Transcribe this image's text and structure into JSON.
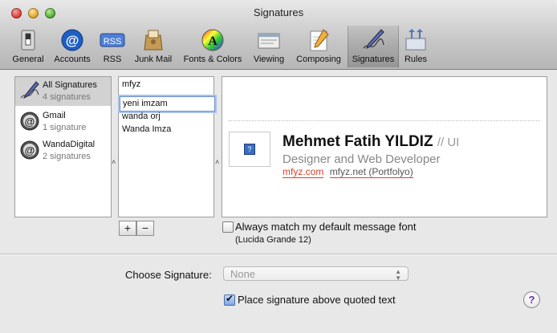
{
  "window": {
    "title": "Signatures"
  },
  "toolbar": {
    "items": [
      {
        "label": "General",
        "icon": "switch-icon"
      },
      {
        "label": "Accounts",
        "icon": "at-sign-icon"
      },
      {
        "label": "RSS",
        "icon": "rss-badge-icon"
      },
      {
        "label": "Junk Mail",
        "icon": "junk-mail-icon"
      },
      {
        "label": "Fonts & Colors",
        "icon": "font-color-icon"
      },
      {
        "label": "Viewing",
        "icon": "viewing-icon"
      },
      {
        "label": "Composing",
        "icon": "pencil-paper-icon"
      },
      {
        "label": "Signatures",
        "icon": "signature-pen-icon",
        "selected": true
      },
      {
        "label": "Rules",
        "icon": "rules-arrows-icon"
      }
    ],
    "rss_badge_text": "RSS"
  },
  "accounts": [
    {
      "name": "All Signatures",
      "count": "4 signatures",
      "selected": true
    },
    {
      "name": "Gmail",
      "count": "1 signature"
    },
    {
      "name": "WandaDigital",
      "count": "2 signatures"
    }
  ],
  "signatures": {
    "items": [
      "mfyz",
      "wanda orj",
      "Wanda Imza"
    ],
    "editing_value": "yeni imzam",
    "add_label": "+",
    "remove_label": "−"
  },
  "preview": {
    "photo_placeholder": "?",
    "name": "Mehmet Fatih YILDIZ",
    "name_suffix": "// UI",
    "title": "Designer and Web Developer",
    "link1": "mfyz.com",
    "link2": "mfyz.net (Portfolyo)"
  },
  "font_option": {
    "label": "Always match my default message font",
    "checked": false,
    "font_note": "(Lucida Grande 12)"
  },
  "choose_signature": {
    "label": "Choose Signature:",
    "value": "None"
  },
  "place_above": {
    "label": "Place signature above quoted text",
    "checked": true
  },
  "help": {
    "label": "?"
  },
  "colors": {
    "link_red": "#d9422c",
    "help_purple": "#6b2fb0"
  }
}
